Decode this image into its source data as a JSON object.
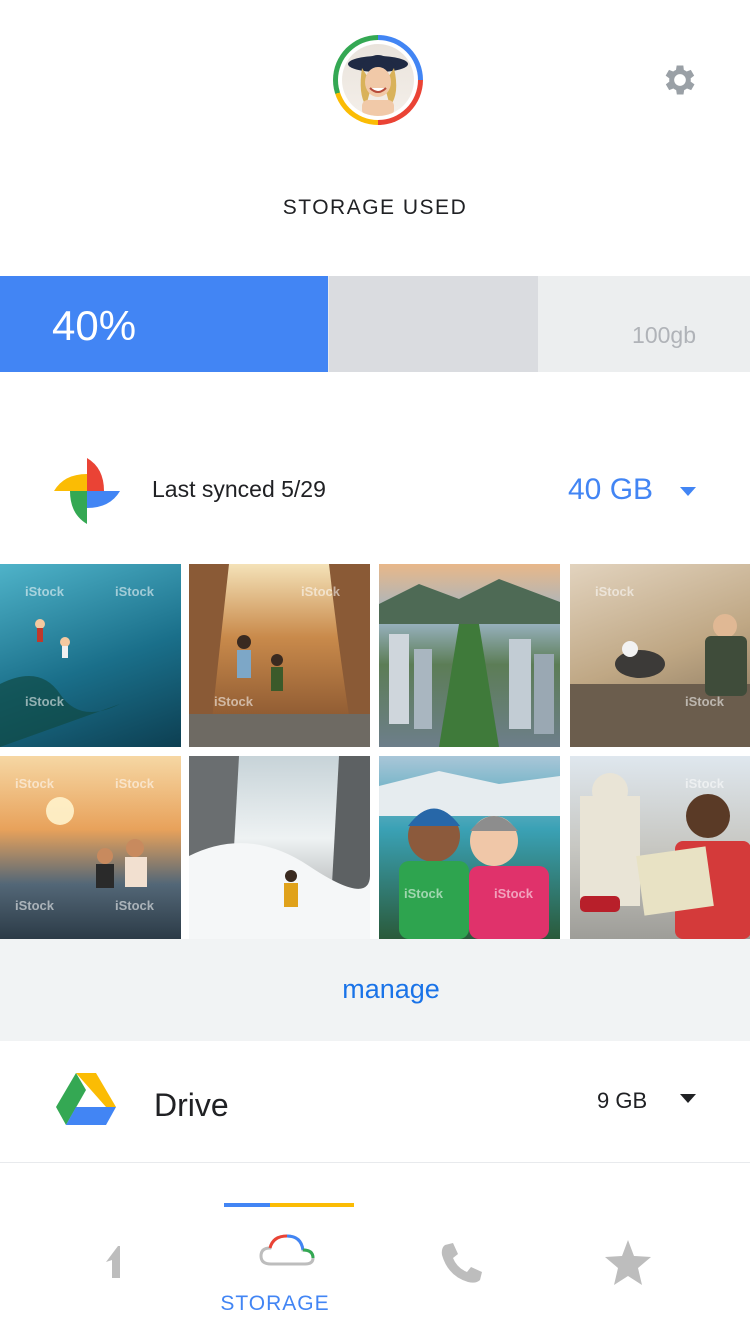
{
  "header": {
    "avatar_icon": "user-avatar",
    "settings_icon": "gear-icon",
    "title": "STORAGE USED"
  },
  "storage": {
    "percent_label": "40%",
    "percent_value": 40,
    "capacity_label": "100gb",
    "colors": {
      "fill": "#4285f4",
      "track": "#dadce0",
      "end": "#eceeef"
    }
  },
  "photos": {
    "icon": "google-photos-icon",
    "synced_label": "Last synced 5/29",
    "size_label": "40 GB",
    "watermark": "iStock",
    "manage_label": "manage"
  },
  "drive": {
    "icon": "google-drive-icon",
    "label": "Drive",
    "size_label": "9 GB"
  },
  "nav": {
    "active_label": "STORAGE",
    "items": [
      "google-one-icon",
      "cloud-icon",
      "phone-icon",
      "star-icon"
    ],
    "accent": "#4285f4"
  }
}
